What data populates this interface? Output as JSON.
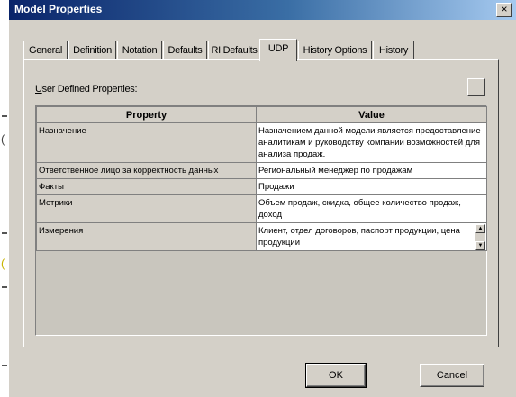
{
  "window": {
    "title": "Model Properties",
    "close_glyph": "×"
  },
  "tabs": [
    {
      "label": "General"
    },
    {
      "label": "Definition"
    },
    {
      "label": "Notation"
    },
    {
      "label": "Defaults"
    },
    {
      "label": "RI Defaults"
    },
    {
      "label": "UDP"
    },
    {
      "label": "History Options"
    },
    {
      "label": "History"
    }
  ],
  "active_tab": "UDP",
  "udp_panel": {
    "label_underlined": "U",
    "label_rest": "ser Defined Properties:"
  },
  "grid": {
    "headers": [
      "Property",
      "Value"
    ],
    "rows": [
      {
        "property": "Назначение",
        "value": "Назначением данной модели является предоставление аналитикам и руководству компании возможностей для анализа продаж."
      },
      {
        "property": "Ответственное лицо за корректность данных",
        "value": "Региональный менеджер по продажам"
      },
      {
        "property": "Факты",
        "value": "Продажи"
      },
      {
        "property": "Метрики",
        "value": "Объем продаж, скидка, общее количество продаж, доход"
      },
      {
        "property": "Измерения",
        "value": "Клиент, отдел договоров, паспорт продукции, цена продукции"
      }
    ]
  },
  "buttons": {
    "ok": "OK",
    "cancel": "Cancel"
  }
}
